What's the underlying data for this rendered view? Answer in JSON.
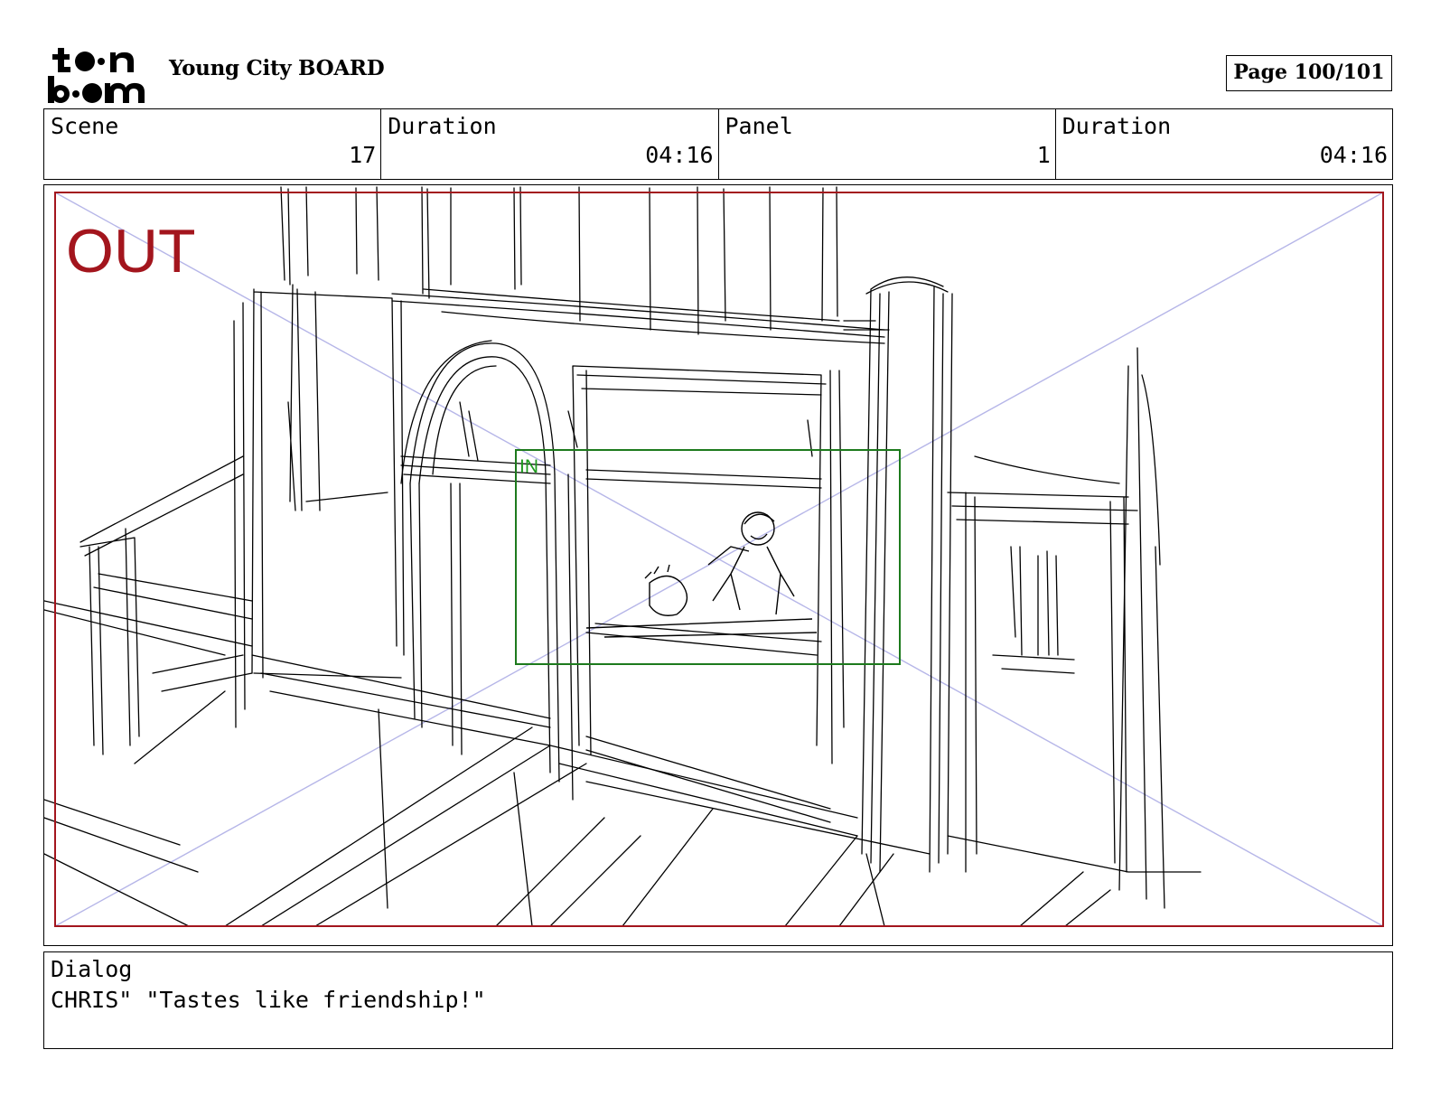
{
  "header": {
    "logo_text": [
      "toon",
      "boom"
    ],
    "project_title": "Young City BOARD",
    "page_label": "Page 100/101"
  },
  "info": {
    "scene_label": "Scene",
    "scene_value": "17",
    "scene_duration_label": "Duration",
    "scene_duration_value": "04:16",
    "panel_label": "Panel",
    "panel_value": "1",
    "panel_duration_label": "Duration",
    "panel_duration_value": "04:16"
  },
  "panel": {
    "out_label": "OUT",
    "in_label": "IN",
    "colors": {
      "out_frame": "#a3151d",
      "in_frame": "#1d7a1d",
      "guide_lines": "#b6b6e8",
      "sketch": "#000000"
    }
  },
  "dialog": {
    "label": "Dialog",
    "text": "CHRIS\" \"Tastes like friendship!\""
  }
}
